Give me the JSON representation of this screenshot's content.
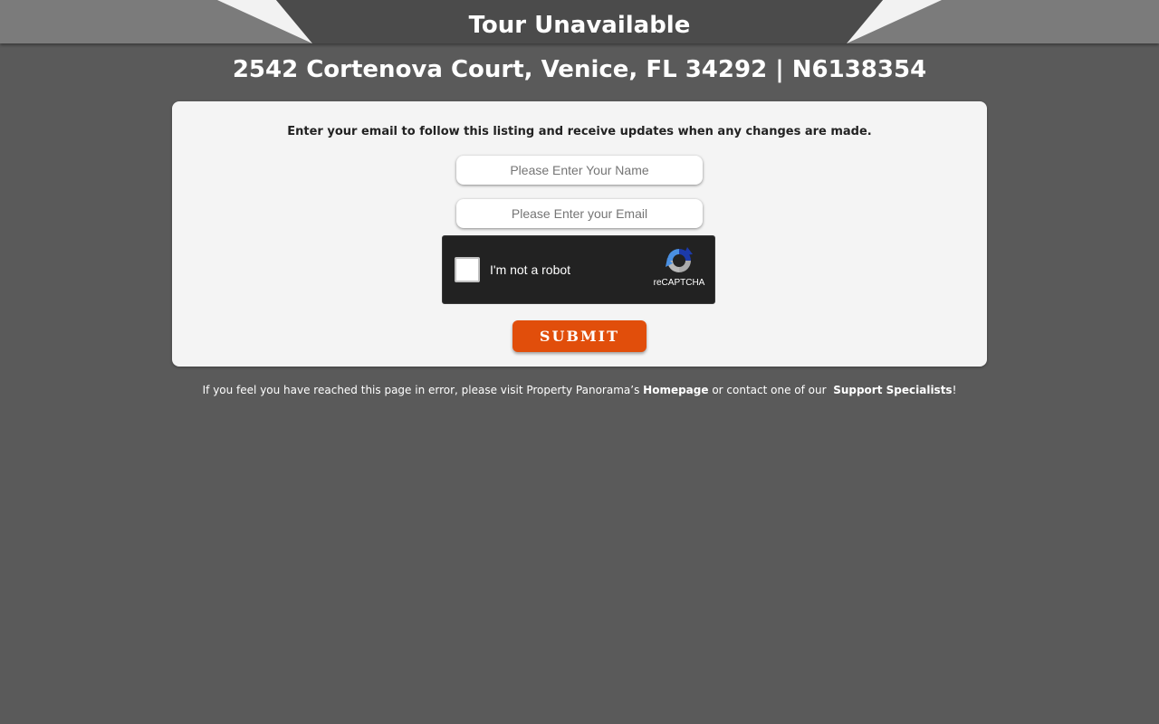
{
  "header": {
    "title": "Tour Unavailable"
  },
  "listing": {
    "address": "2542 Cortenova Court, Venice, FL 34292 | N6138354"
  },
  "form": {
    "intro": "Enter your email to follow this listing and receive updates when any changes are made.",
    "name_placeholder": "Please Enter Your Name",
    "email_placeholder": "Please Enter your Email",
    "submit_label": "SUBMIT"
  },
  "recaptcha": {
    "label": "I'm not a robot",
    "brand": "reCAPTCHA",
    "icon": "recaptcha-logo-icon"
  },
  "footer": {
    "text_before": "If you feel you have reached this page in error, please visit Property Panorama’s ",
    "homepage_link": "Homepage",
    "text_middle": " or contact one of our  ",
    "support_link": "Support Specialists",
    "text_after": "!"
  },
  "colors": {
    "background": "#5a5a5a",
    "card": "#f4f4f4",
    "submit": "#e14e0b",
    "header_dark": "#4a4a4a",
    "header_light": "#7a7a7a"
  }
}
